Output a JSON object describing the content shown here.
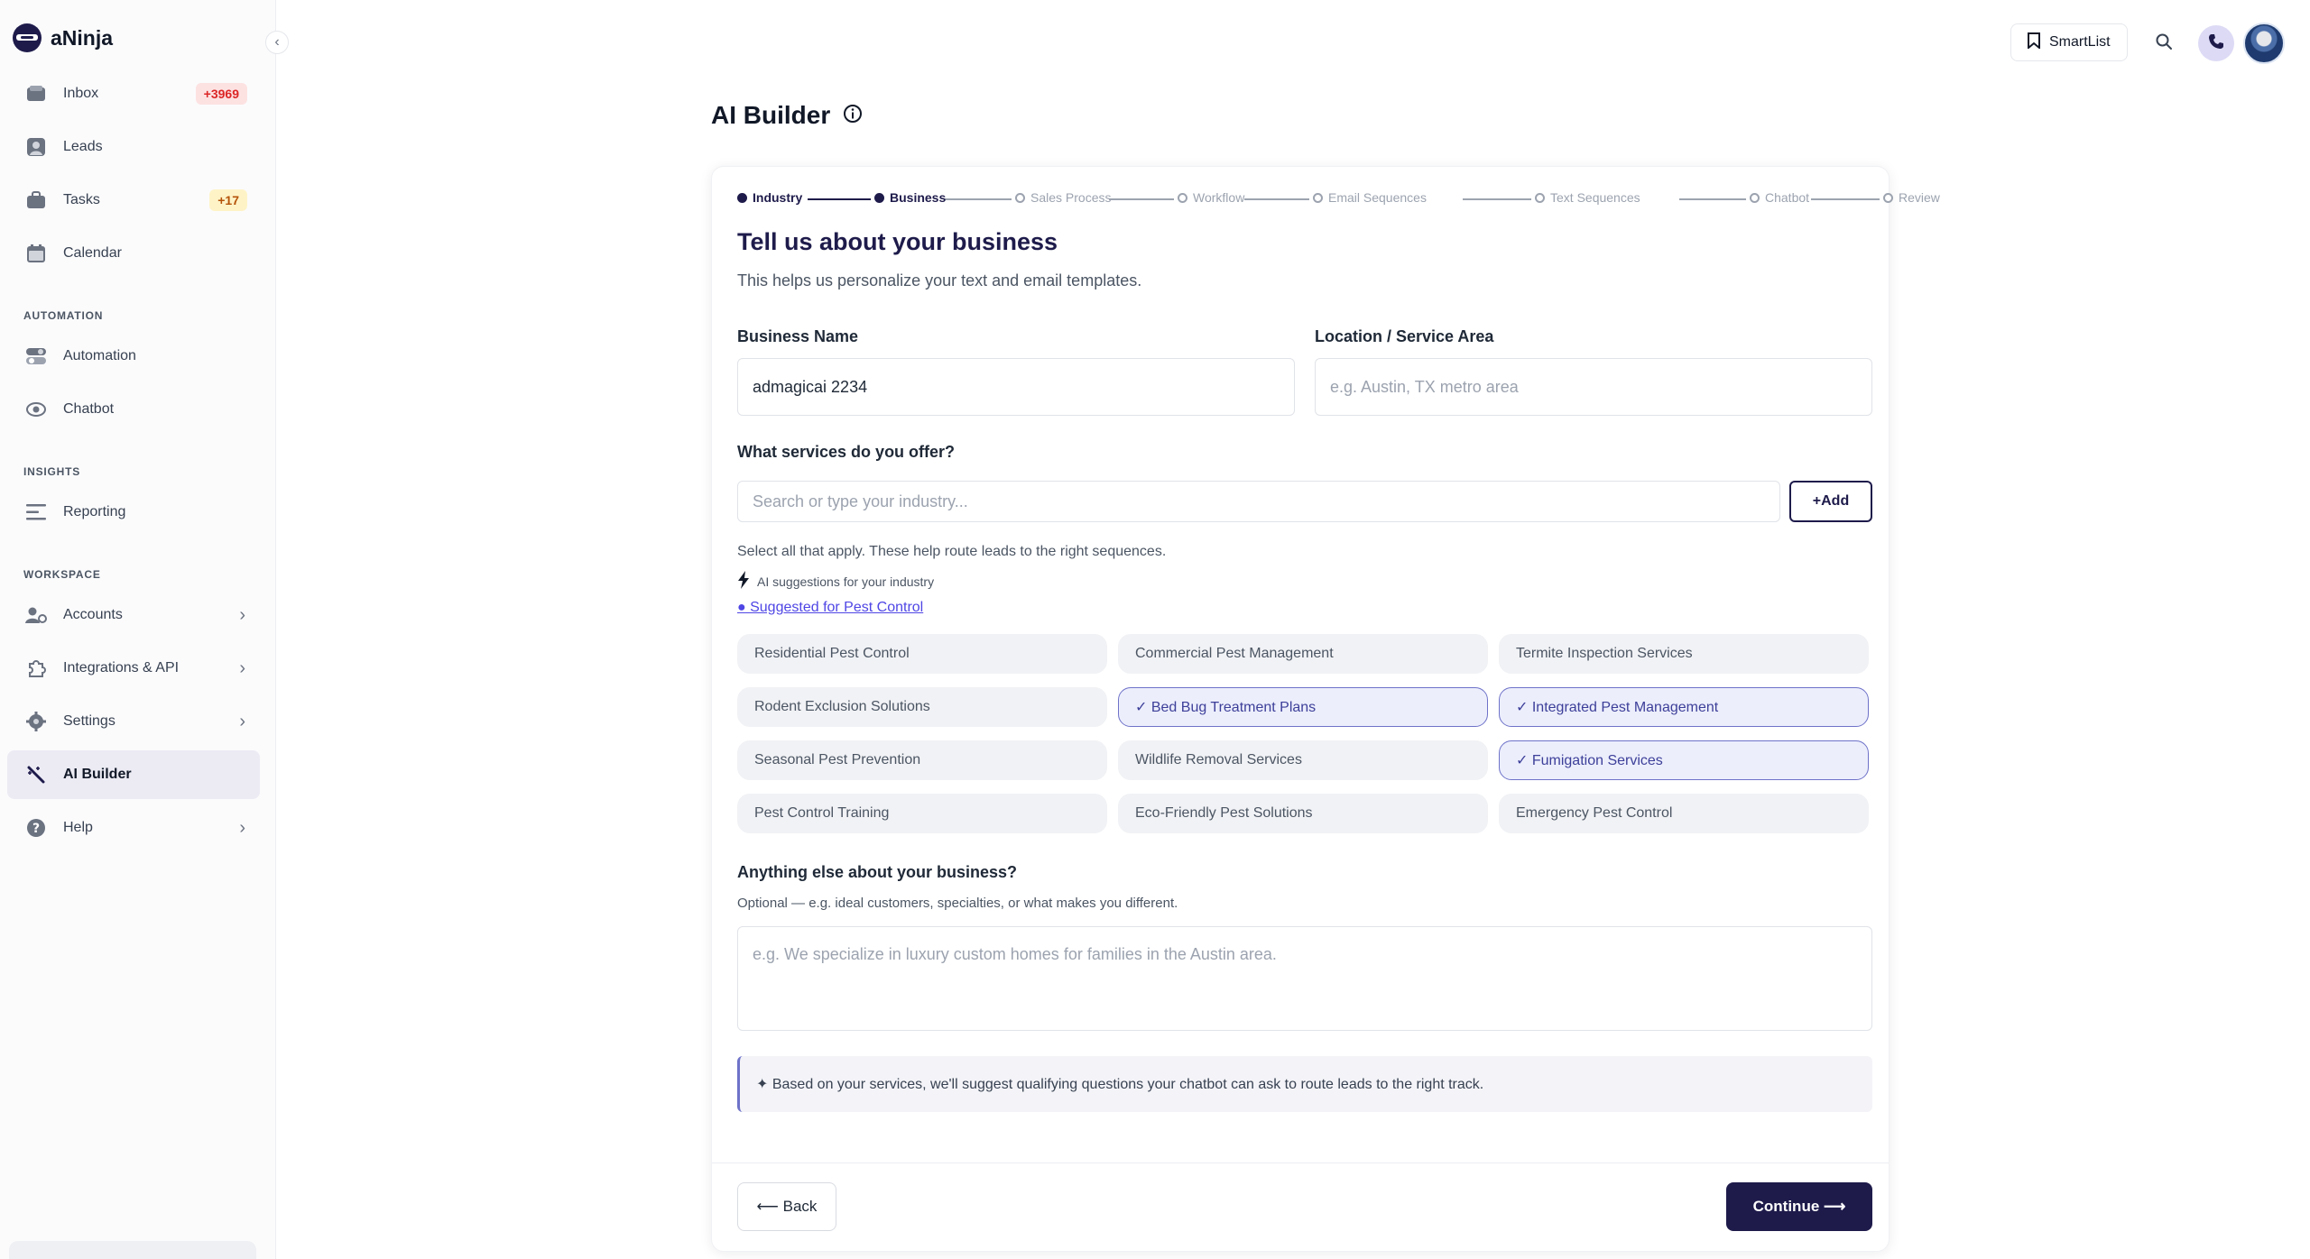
{
  "app": {
    "name": "aNinja"
  },
  "sidebar": {
    "primary": [
      {
        "label": "Inbox",
        "badge": "+3969",
        "icon": "inbox-icon"
      },
      {
        "label": "Leads",
        "icon": "user-icon"
      },
      {
        "label": "Tasks",
        "badge": "+17",
        "icon": "briefcase-icon"
      },
      {
        "label": "Calendar",
        "icon": "calendar-icon"
      }
    ],
    "automation_title": "AUTOMATION",
    "automation": [
      {
        "label": "Automation",
        "icon": "toggle-icon"
      },
      {
        "label": "Chatbot",
        "icon": "eye-icon"
      }
    ],
    "insights_title": "INSIGHTS",
    "insights": [
      {
        "label": "Reporting",
        "icon": "bars-icon"
      }
    ],
    "workspace_title": "WORKSPACE",
    "workspace": [
      {
        "label": "Accounts",
        "icon": "accounts-icon"
      },
      {
        "label": "Integrations & API",
        "icon": "puzzle-icon"
      },
      {
        "label": "Settings",
        "icon": "gear-icon"
      },
      {
        "label": "AI Builder",
        "icon": "wand-icon",
        "active": true
      },
      {
        "label": "Help",
        "icon": "help-icon"
      }
    ]
  },
  "header": {
    "smartlist_label": "SmartList"
  },
  "page": {
    "title": "AI Builder"
  },
  "stepper": {
    "steps": [
      {
        "label": "Industry",
        "done": true
      },
      {
        "label": "Business",
        "done": true
      },
      {
        "label": "Sales Process",
        "done": false
      },
      {
        "label": "Workflow",
        "done": false
      },
      {
        "label": "Email Sequences",
        "done": false
      },
      {
        "label": "Text Sequences",
        "done": false
      },
      {
        "label": "Chatbot",
        "done": false
      },
      {
        "label": "Review",
        "done": false
      }
    ]
  },
  "form": {
    "heading": "Tell us about your business",
    "subheading": "This helps us personalize your text and email templates.",
    "business_name_label": "Business Name",
    "business_name_value": "admagicai 2234",
    "location_label": "Location / Service Area",
    "location_placeholder": "e.g. Austin, TX metro area",
    "services_label": "What services do you offer?",
    "search_placeholder": "Search or type your industry...",
    "add_label": "+Add",
    "helper_text": "Select all that apply. These help route leads to the right sequences.",
    "ai_suggestions_text": "AI suggestions for your industry",
    "suggested_link": "● Suggested for Pest Control",
    "services": [
      {
        "label": "Residential Pest Control",
        "selected": false
      },
      {
        "label": "Commercial Pest Management",
        "selected": false
      },
      {
        "label": "Termite Inspection Services",
        "selected": false
      },
      {
        "label": "Rodent Exclusion Solutions",
        "selected": false
      },
      {
        "label": "✓ Bed Bug Treatment Plans",
        "selected": true
      },
      {
        "label": "✓ Integrated Pest Management",
        "selected": true
      },
      {
        "label": "Seasonal Pest Prevention",
        "selected": false
      },
      {
        "label": "Wildlife Removal Services",
        "selected": false
      },
      {
        "label": "✓ Fumigation Services",
        "selected": true
      },
      {
        "label": "Pest Control Training",
        "selected": false
      },
      {
        "label": "Eco-Friendly Pest Solutions",
        "selected": false
      },
      {
        "label": "Emergency Pest Control",
        "selected": false
      }
    ],
    "notes_label": "Anything else about your business?",
    "notes_sub": "Optional — e.g. ideal customers, specialties, or what makes you different.",
    "notes_placeholder": "e.g. We specialize in luxury custom homes for families in the Austin area.",
    "info_text": "✦ Based on your services, we'll suggest qualifying questions your chatbot can ask to route leads to the right track.",
    "back_label": "⟵ Back",
    "continue_label": "Continue ⟶"
  },
  "colors": {
    "brand": "#1e1b4b",
    "accent": "#6e72c8",
    "badge_red": "#dc2626",
    "badge_amber": "#b45309"
  }
}
